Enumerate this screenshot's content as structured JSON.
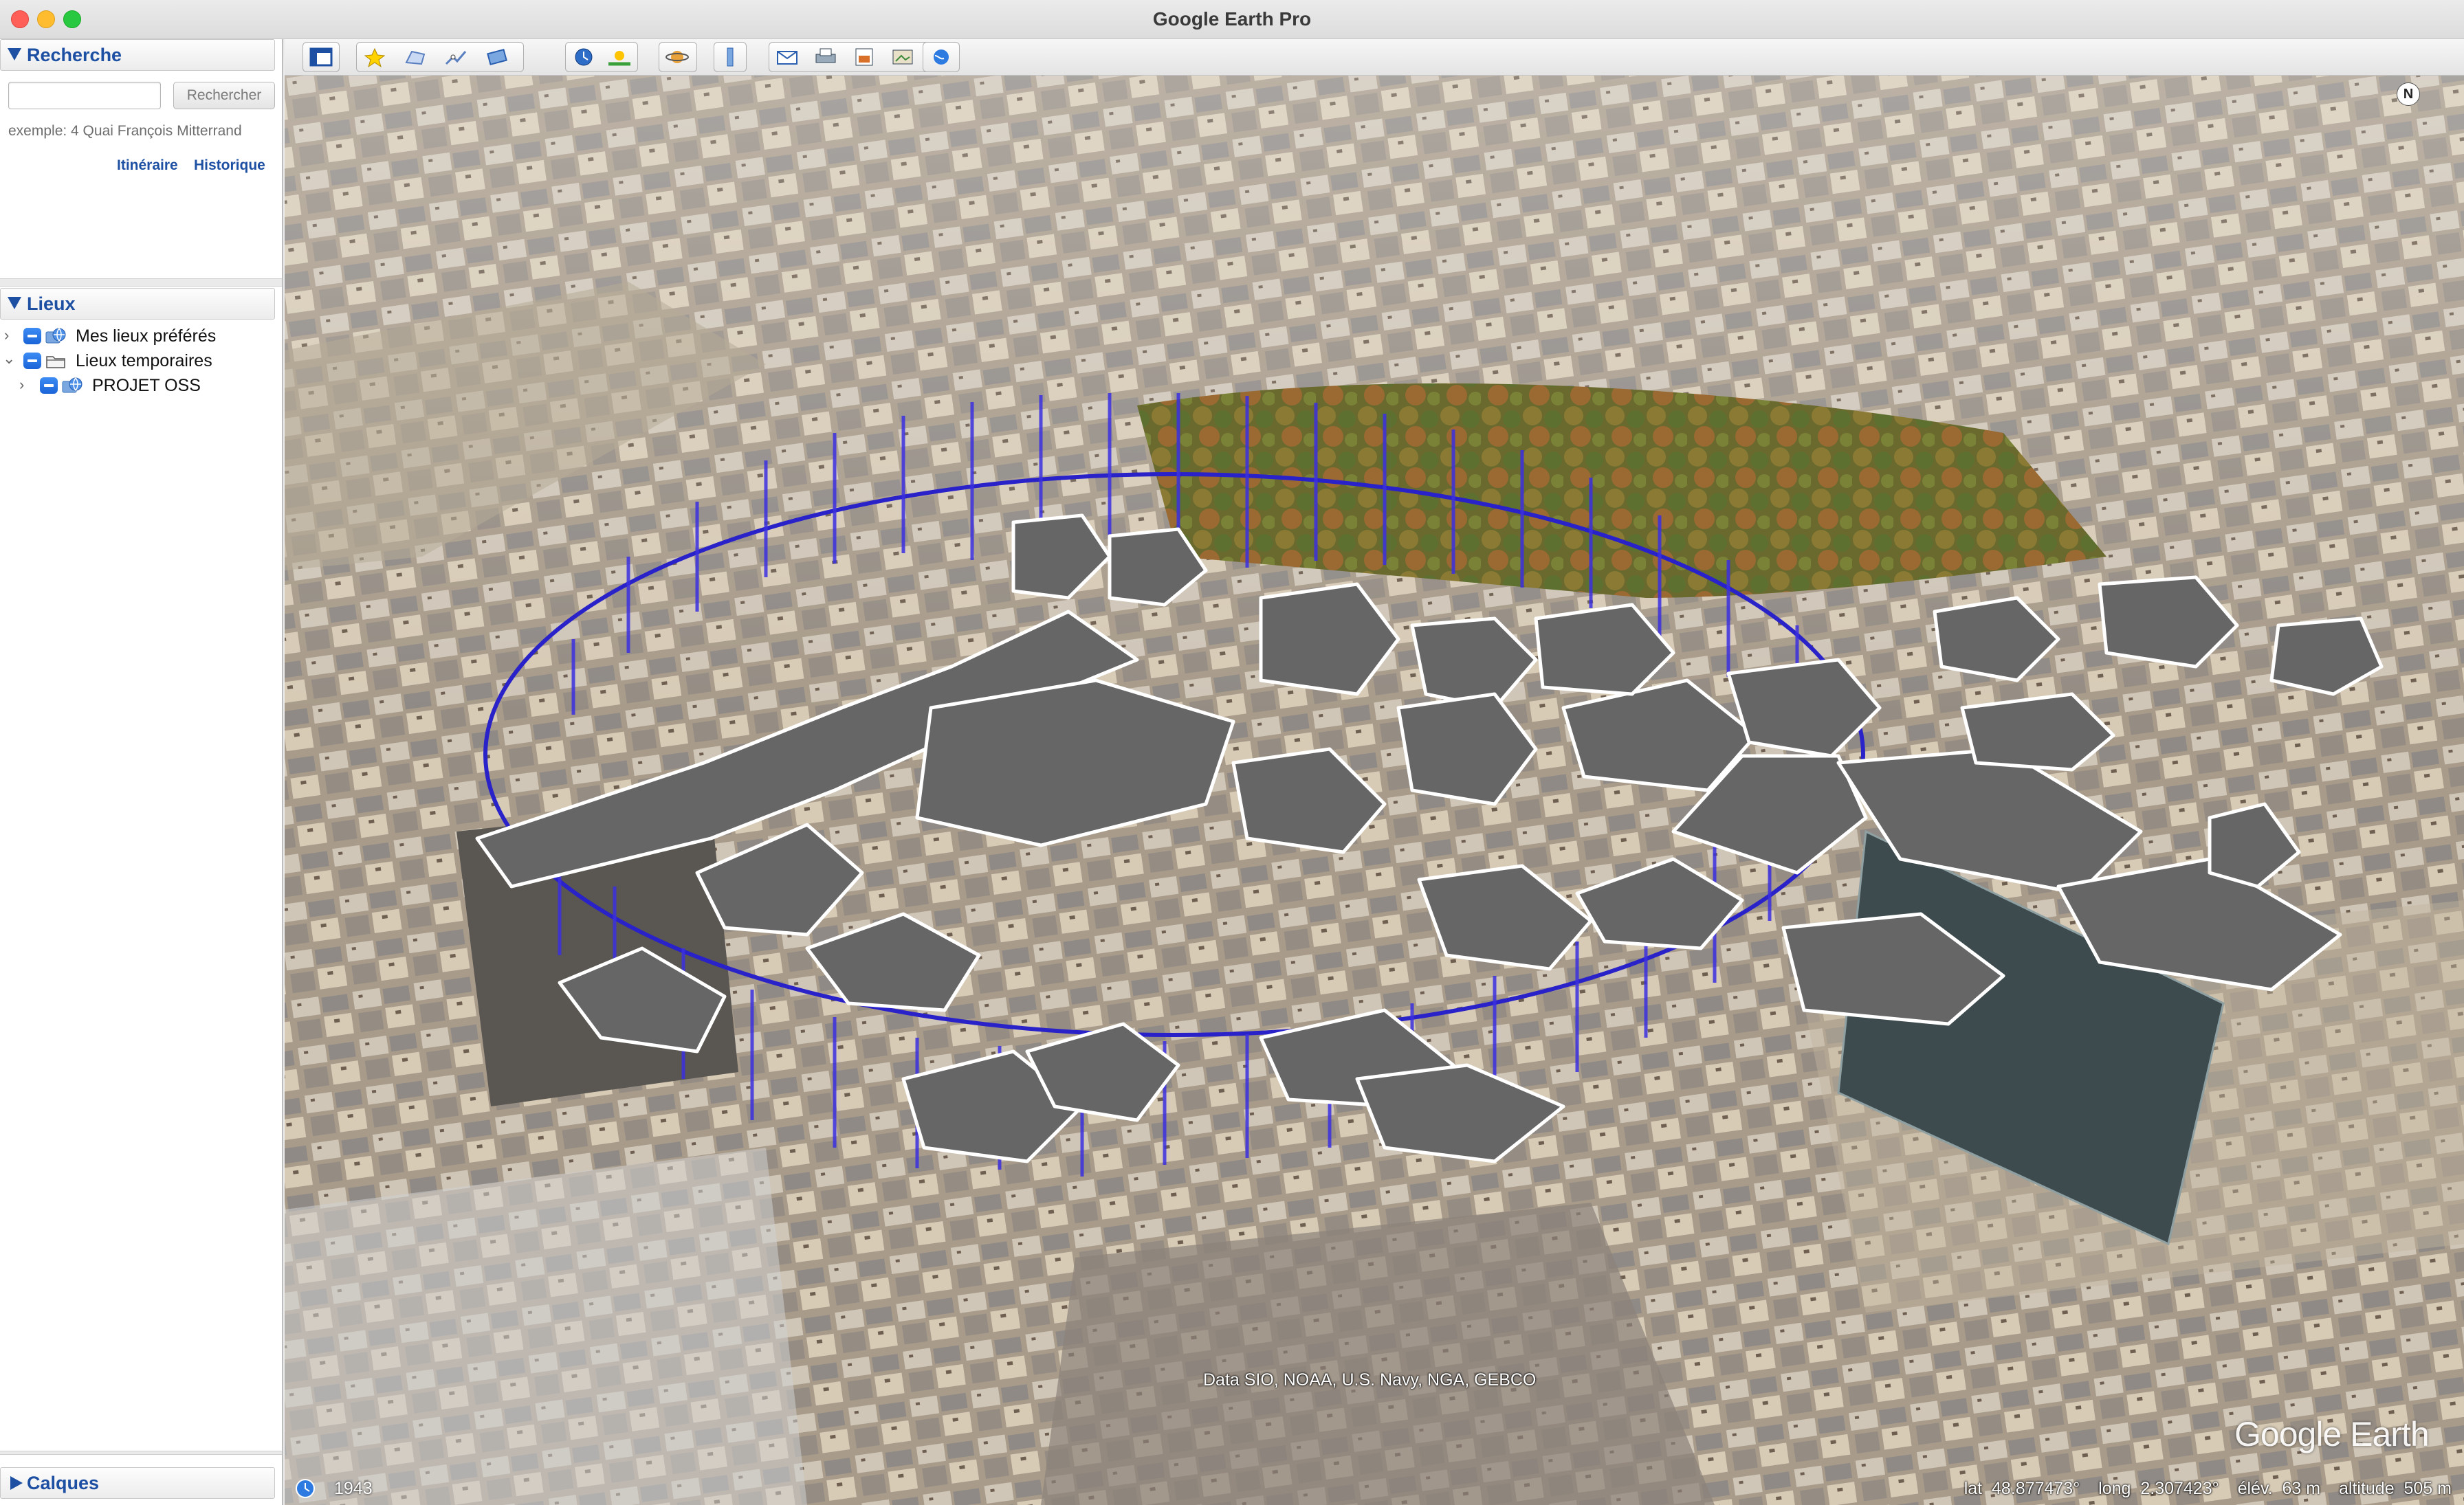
{
  "window": {
    "title": "Google Earth Pro"
  },
  "search": {
    "header": "Recherche",
    "input_value": "",
    "button_label": "Rechercher",
    "example": "exemple:  4 Quai François Mitterrand",
    "link_itinerary": "Itinéraire",
    "link_history": "Historique"
  },
  "places": {
    "header": "Lieux",
    "items": [
      {
        "label": "Mes lieux préférés",
        "expanded": false,
        "icon": "globe-folder-icon"
      },
      {
        "label": "Lieux temporaires",
        "expanded": true,
        "icon": "folder-icon"
      },
      {
        "label": "PROJET OSS",
        "expanded": false,
        "icon": "globe-folder-icon"
      }
    ]
  },
  "layers": {
    "header": "Calques"
  },
  "toolbar": {
    "buttons": [
      "sidebar-toggle-icon",
      "placemark-icon",
      "polygon-icon",
      "path-icon",
      "image-overlay-icon",
      "record-tour-icon",
      "historical-imagery-icon",
      "sunlight-icon",
      "planets-icon",
      "ruler-icon",
      "email-icon",
      "print-icon",
      "save-image-icon",
      "view-in-maps-icon",
      "google-earth-icon"
    ]
  },
  "map": {
    "compass_label": "N",
    "attribution": "Data SIO, NOAA, U.S. Navy, NGA, GEBCO",
    "brand": "Google Earth",
    "year": "1943",
    "lat_label": "lat",
    "lat_value": "48.877473°",
    "long_label": "long",
    "long_value": "2.307423°",
    "elev_label": "élév.",
    "elev_value": "63 m",
    "alt_label": "altitude",
    "alt_value": "505 m"
  },
  "colors": {
    "accent": "#1d4fa3",
    "boundary": "#2a22c9",
    "footprint_fill": "#666666",
    "footprint_stroke": "#ffffff"
  }
}
